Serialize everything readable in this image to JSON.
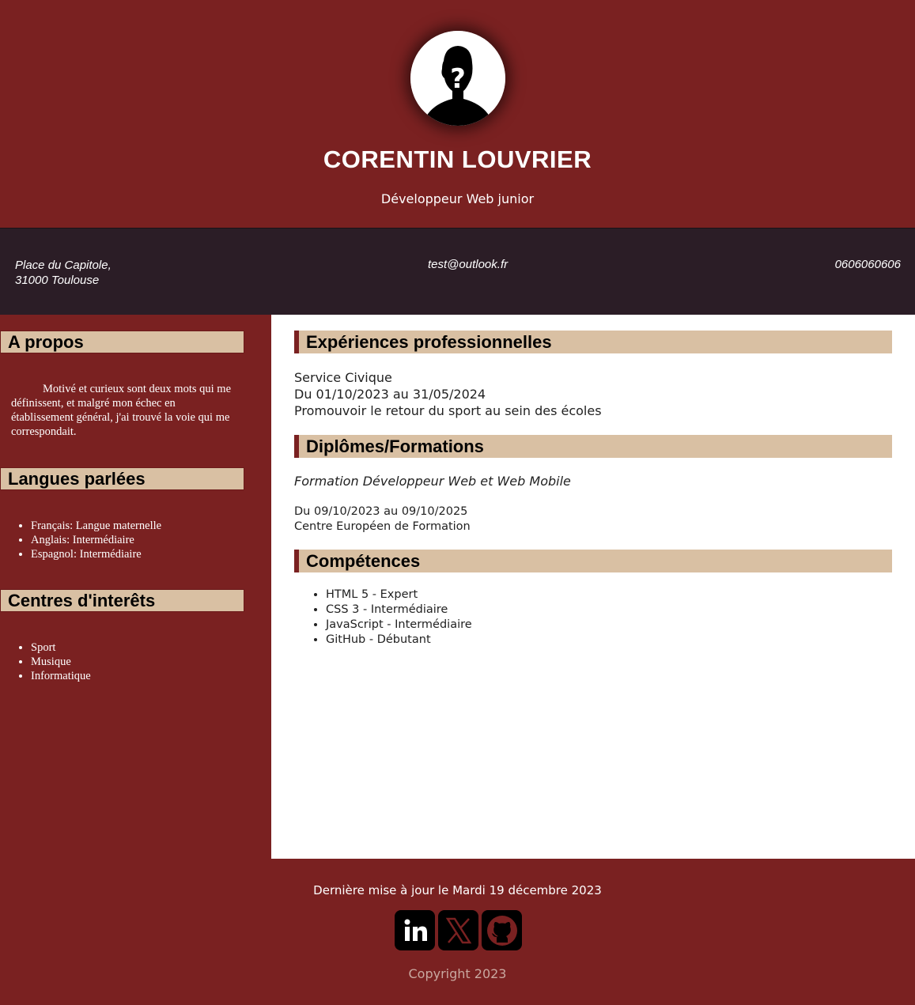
{
  "header": {
    "name": "CORENTIN LOUVRIER",
    "job_title": "Développeur Web junior",
    "avatar_icon": "unknown-person-icon"
  },
  "contact": {
    "address_line1": "Place du Capitole,",
    "address_line2": "31000 Toulouse",
    "email": "test@outlook.fr",
    "phone": "0606060606"
  },
  "sidebar": {
    "about": {
      "title": "A propos",
      "text": "Motivé et curieux sont deux mots qui me définissent, et malgré mon échec en établissement général, j'ai trouvé la voie qui me correspondait."
    },
    "languages": {
      "title": "Langues parlées",
      "items": [
        "Français: Langue maternelle",
        "Anglais: Intermédiaire",
        "Espagnol: Intermédiaire"
      ]
    },
    "interests": {
      "title": "Centres d'interêts",
      "items": [
        "Sport",
        "Musique",
        "Informatique"
      ]
    }
  },
  "main": {
    "experience": {
      "title": "Expériences professionnelles",
      "position": "Service Civique",
      "dates": "Du 01/10/2023 au 31/05/2024",
      "description": "Promouvoir le retour du sport au sein des écoles"
    },
    "education": {
      "title": "Diplômes/Formations",
      "name": "Formation Développeur Web et Web Mobile",
      "dates": "Du 09/10/2023 au 09/10/2025",
      "school": "Centre Européen de Formation"
    },
    "skills": {
      "title": "Compétences",
      "items": [
        "HTML 5 - Expert",
        "CSS 3 - Intermédiaire",
        "JavaScript - Intermédiaire",
        "GitHub - Débutant"
      ]
    }
  },
  "footer": {
    "last_update": "Dernière mise à jour le Mardi 19 décembre 2023",
    "socials": [
      {
        "icon": "linkedin-icon"
      },
      {
        "icon": "x-twitter-icon"
      },
      {
        "icon": "github-icon"
      }
    ],
    "copyright": "Copyright 2023"
  },
  "colors": {
    "primary": "#7a2121",
    "contact_bar": "#2b1d26",
    "heading_bg": "#d9c0a3"
  }
}
